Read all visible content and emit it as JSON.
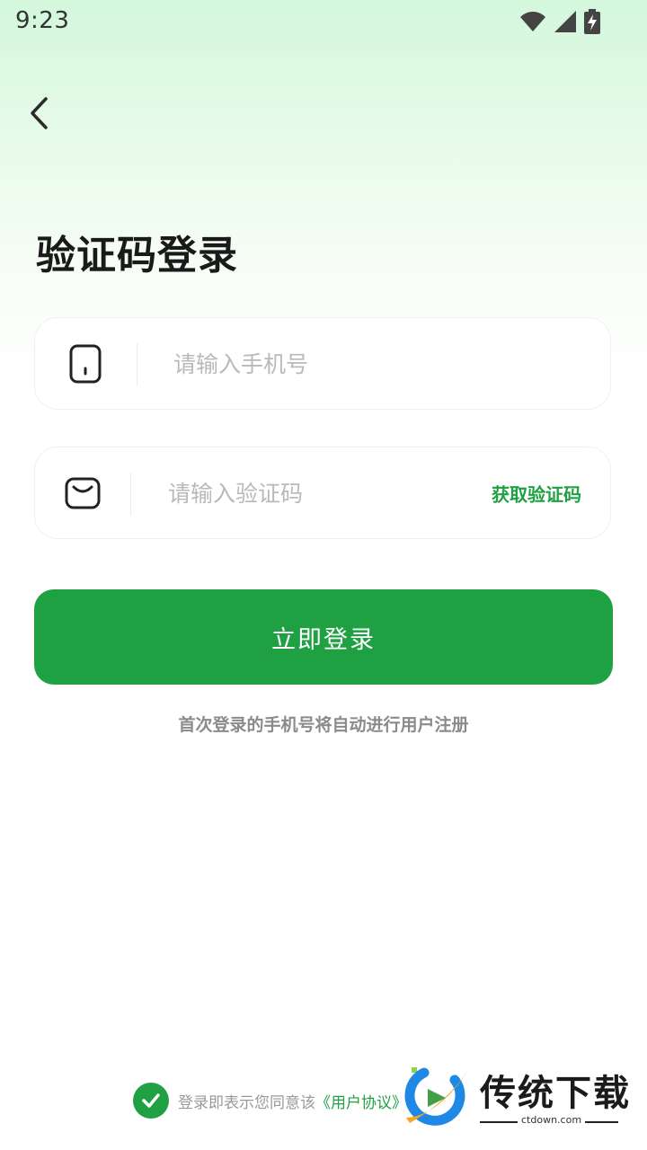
{
  "status_bar": {
    "time": "9:23",
    "icons": [
      "wifi-icon",
      "signal-icon",
      "battery-charging-icon"
    ]
  },
  "nav": {
    "back_icon": "chevron-left-icon"
  },
  "page": {
    "title": "验证码登录"
  },
  "phone_field": {
    "icon": "phone-icon",
    "placeholder": "请输入手机号",
    "value": ""
  },
  "code_field": {
    "icon": "message-icon",
    "placeholder": "请输入验证码",
    "value": "",
    "get_code_label": "获取验证码"
  },
  "login_button": {
    "label": "立即登录"
  },
  "register_hint": "首次登录的手机号将自动进行用户注册",
  "agreement": {
    "checked": true,
    "text": "登录即表示您同意该",
    "link_label": "《用户协议》"
  },
  "watermark": {
    "title": "传统下载",
    "site": "ctdown.com"
  },
  "colors": {
    "primary": "#1fa043",
    "background_top": "#d3f7dc",
    "placeholder": "#b9b9b9"
  }
}
